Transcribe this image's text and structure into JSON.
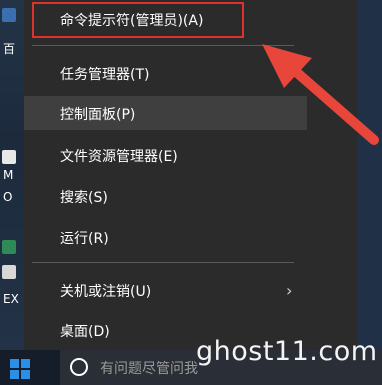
{
  "desktop": {
    "labels": [
      "百",
      "M",
      "O",
      "EX"
    ]
  },
  "menu": {
    "items": [
      {
        "label": "命令提示符(管理员)(A)"
      },
      {
        "label": "任务管理器(T)"
      },
      {
        "label": "控制面板(P)"
      },
      {
        "label": "文件资源管理器(E)"
      },
      {
        "label": "搜索(S)"
      },
      {
        "label": "运行(R)"
      },
      {
        "label": "关机或注销(U)"
      },
      {
        "label": "桌面(D)"
      }
    ]
  },
  "taskbar": {
    "search_placeholder": "有问题尽管问我"
  },
  "watermark": "ghost11.com",
  "colors": {
    "menu_bg": "#2b2b2b",
    "highlight_box": "#e0322c",
    "arrow": "#e8463a",
    "hover_bg": "#3f3f3f"
  }
}
